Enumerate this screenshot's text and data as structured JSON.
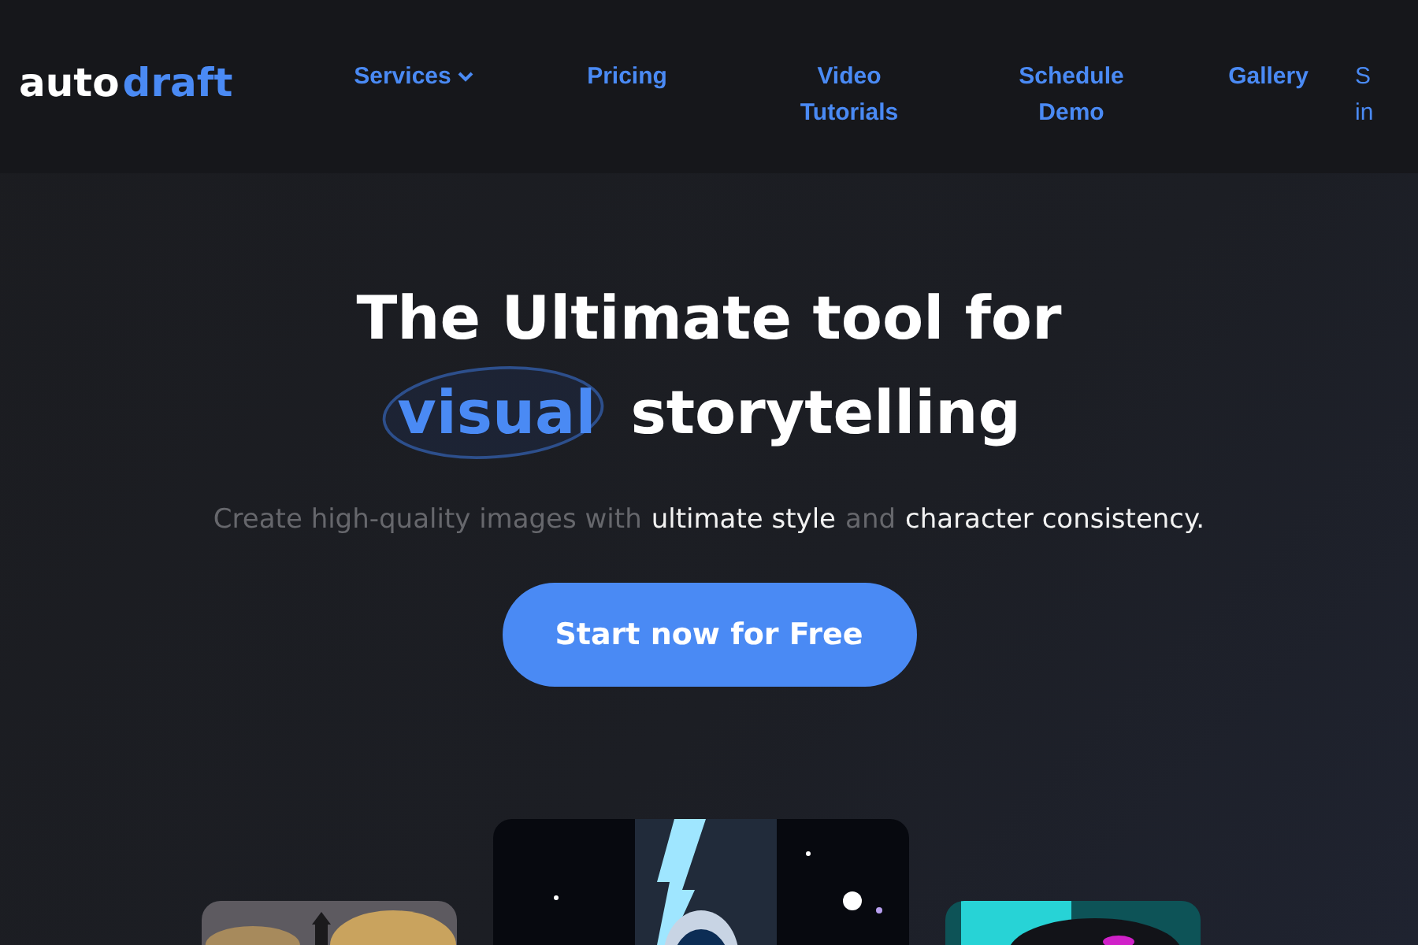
{
  "header": {
    "logo": {
      "part_1": "auto",
      "part_2": "draft"
    },
    "nav": [
      {
        "label": "Services",
        "dropdown": true
      },
      {
        "label": "Pricing",
        "dropdown": false
      },
      {
        "label": "Video Tutorials",
        "dropdown": false
      },
      {
        "label": "Schedule Demo",
        "dropdown": false
      },
      {
        "label": "Gallery",
        "dropdown": false
      },
      {
        "label": "S in",
        "dropdown": false
      }
    ]
  },
  "hero": {
    "title_line_1": "The Ultimate tool for",
    "highlight": "visual",
    "title_rest": "storytelling",
    "subtitle": [
      {
        "text": "Create high-quality images with",
        "emphasis": false
      },
      {
        "text": "ultimate style",
        "emphasis": true
      },
      {
        "text": "and",
        "emphasis": false
      },
      {
        "text": "character consistency.",
        "emphasis": true
      }
    ],
    "cta": "Start now for Free"
  }
}
